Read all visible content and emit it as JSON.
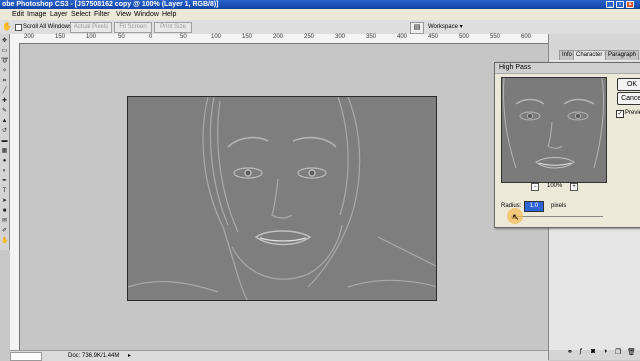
{
  "title_bar": {
    "title": "obe Photoshop CS3 - [JS7508162 copy @ 100% (Layer 1, RGB/8)]"
  },
  "menu": [
    "Edit",
    "Image",
    "Layer",
    "Select",
    "Filter",
    "View",
    "Window",
    "Help"
  ],
  "options_bar": {
    "scroll_all_label": "Scroll All Windows",
    "actual_pixels": "Actual Pixels",
    "fit_screen": "Fit Screen",
    "print_size": "Print Size",
    "workspace": "Workspace ▾"
  },
  "ruler_ticks": [
    "200",
    "150",
    "100",
    "50",
    "0",
    "50",
    "100",
    "150",
    "200",
    "250",
    "300",
    "350",
    "400",
    "450",
    "500",
    "550",
    "600"
  ],
  "status": {
    "doc": "Doc: 736.9K/1.44M"
  },
  "panel_tabs": [
    "Info",
    "Character ×",
    "Paragraph"
  ],
  "dialog": {
    "title": "High Pass",
    "ok": "OK",
    "cancel": "Cancel",
    "preview_label": "Preview",
    "zoom": "100%",
    "radius_label": "Radius:",
    "radius_value": "1.0",
    "unit": "pixels"
  }
}
